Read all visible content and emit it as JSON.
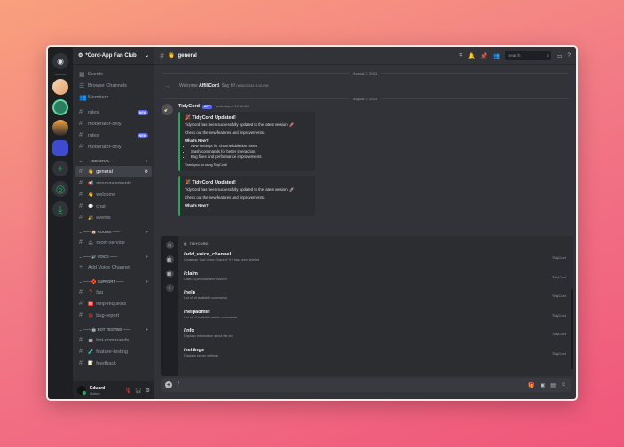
{
  "server": {
    "name": "*Cord-App Fan Club",
    "rail_icons": [
      "home-icon",
      "server-avatar-1",
      "server-avatar-2",
      "server-avatar-3",
      "server-avatar-4",
      "add-server-icon",
      "explore-icon",
      "download-icon"
    ]
  },
  "sidebar": {
    "top_items": [
      {
        "icon": "calendar-icon",
        "label": "Events"
      },
      {
        "icon": "browse-icon",
        "label": "Browse Channels"
      },
      {
        "icon": "members-icon",
        "label": "Members"
      }
    ],
    "pinned": [
      {
        "label": "rules",
        "badge": "NEW"
      },
      {
        "label": "moderator-only",
        "badge": ""
      },
      {
        "label": "rules",
        "badge": "NEW"
      },
      {
        "label": "moderator-only",
        "badge": ""
      }
    ],
    "categories": [
      {
        "name": "GENERAL",
        "emoji": "",
        "channels": [
          {
            "emoji": "👋",
            "label": "general",
            "active": true
          },
          {
            "emoji": "📢",
            "label": "announcements"
          },
          {
            "emoji": "👋",
            "label": "welcome"
          },
          {
            "emoji": "💬",
            "label": "chat"
          },
          {
            "emoji": "🎉",
            "label": "events"
          }
        ]
      },
      {
        "name": "ROOMS",
        "emoji": "🏠",
        "channels": [
          {
            "emoji": "🛎",
            "label": "room-service"
          }
        ]
      },
      {
        "name": "VOICE",
        "emoji": "🔊",
        "channels": [
          {
            "emoji": "",
            "label": "Add Voice Channel",
            "plus": true
          }
        ]
      },
      {
        "name": "SUPPORT",
        "emoji": "🛟",
        "channels": [
          {
            "emoji": "❓",
            "label": "faq"
          },
          {
            "emoji": "🆘",
            "label": "help-requests"
          },
          {
            "emoji": "🐞",
            "label": "bug-report"
          }
        ]
      },
      {
        "name": "BOT TESTING",
        "emoji": "🤖",
        "channels": [
          {
            "emoji": "🤖",
            "label": "bot-commands"
          },
          {
            "emoji": "🧪",
            "label": "feature-testing"
          },
          {
            "emoji": "📝",
            "label": "feedback"
          }
        ]
      }
    ]
  },
  "user": {
    "name": "Eduard",
    "status": "Online"
  },
  "channel": {
    "name": "general",
    "emoji": "👋"
  },
  "search": {
    "placeholder": "Search"
  },
  "messages": {
    "date1": "August 3, 2024",
    "welcome_prefix": "Welcome",
    "welcome_user": "AffiliCord",
    "welcome_suffix": "Say hi!",
    "welcome_time": "08/02/2024 6:10 PM",
    "date2": "August 3, 2024",
    "author": "TidyCord",
    "app_badge": "APP",
    "time": "Yesterday at 12:06 AM",
    "embed": {
      "title": "🎉 TidyCord Updated!",
      "line1": "TidyCord has been successfully updated to the latest version! 🚀",
      "line2": "Check out the new features and improvements.",
      "heading": "What's New?",
      "bullets": [
        "New settings for channel deletion times",
        "Slash commands for better interaction",
        "Bug fixes and performance improvements"
      ],
      "footer": "Thank you for using TidyCord!"
    },
    "embed2": {
      "title": "🎉 TidyCord Updated!",
      "line1": "TidyCord has been successfully updated to the latest version! 🚀",
      "line2": "Check out the new features and improvements.",
      "heading": "What's New?"
    }
  },
  "commands": {
    "header": "TIDYCORD",
    "items": [
      {
        "name": "/add_voice_channel",
        "desc": "Create an 'Add Voice Channel' if it has been deleted",
        "source": "TidyCord"
      },
      {
        "name": "/claim",
        "desc": "Claim a personal text channel",
        "source": "TidyCord"
      },
      {
        "name": "/help",
        "desc": "List of all available commands",
        "source": "TidyCord"
      },
      {
        "name": "/helpadmin",
        "desc": "List of all available admin commands",
        "source": "TidyCord"
      },
      {
        "name": "/info",
        "desc": "Displays information about the bot",
        "source": "TidyCord"
      },
      {
        "name": "/settings",
        "desc": "Displays server settings",
        "source": "TidyCord"
      }
    ]
  },
  "input": {
    "value": "/"
  }
}
